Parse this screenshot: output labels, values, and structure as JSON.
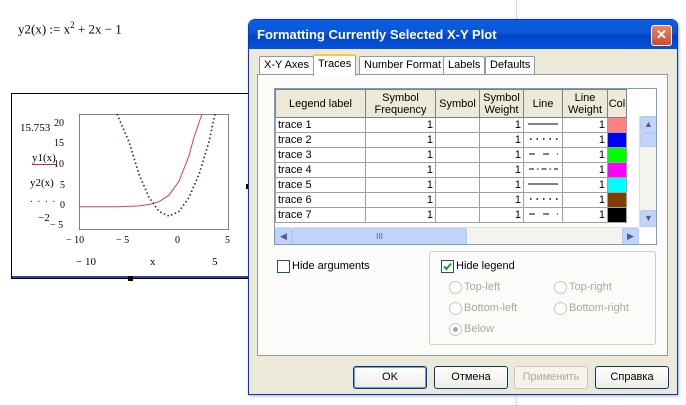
{
  "worksheet": {
    "equation_lhs": "y2(x) := x",
    "equation_exp": "2",
    "equation_rhs": " + 2x − 1",
    "plot": {
      "y_top_label": "15.753",
      "y_bottom_label": "−2",
      "y_trace1": "y1(x)",
      "y_trace2": "y2(x)",
      "x_left_label": "− 10",
      "x_right_label": "5",
      "x_var": "x",
      "y_ticks": [
        "20",
        "15",
        "10",
        "5",
        "0",
        "− 5"
      ],
      "x_ticks": [
        "− 10",
        "− 5",
        "0",
        "5"
      ]
    }
  },
  "chart_data": {
    "type": "line",
    "title": "",
    "xlabel": "x",
    "ylabel": "",
    "xlim": [
      -10,
      5
    ],
    "ylim": [
      -5,
      20
    ],
    "series": [
      {
        "name": "y1(x)",
        "style": "solid",
        "color": "#e04040",
        "x": [
          -10,
          -6,
          -4,
          -3,
          -2,
          -1,
          0,
          1,
          1.5,
          2.3
        ],
        "y": [
          0.0,
          0.02,
          0.2,
          0.5,
          1.1,
          2.5,
          5.5,
          11.0,
          15.0,
          20.0
        ]
      },
      {
        "name": "y2(x)",
        "style": "dotted",
        "color": "#1a1aa0",
        "x": [
          -6.2,
          -5,
          -4,
          -3,
          -2,
          -1,
          0,
          1,
          2,
          3,
          3.6
        ],
        "y": [
          20,
          14,
          7,
          2,
          -1,
          -2,
          -1,
          2,
          7,
          14,
          20
        ]
      }
    ],
    "grid": false,
    "legend": "none"
  },
  "dialog": {
    "title": "Formatting Currently Selected X-Y Plot",
    "tabs": [
      "X-Y Axes",
      "Traces",
      "Number Format",
      "Labels",
      "Defaults"
    ],
    "active_tab": "Traces",
    "columns": [
      "Legend label",
      "Symbol Frequency",
      "Symbol",
      "Symbol Weight",
      "Line",
      "Line Weight",
      "Col"
    ],
    "rows": [
      {
        "label": "trace 1",
        "freq": "1",
        "weight": "1",
        "line": "solid",
        "line_weight": "1",
        "color": "#ff8080"
      },
      {
        "label": "trace 2",
        "freq": "1",
        "weight": "1",
        "line": "dot",
        "line_weight": "1",
        "color": "#0000ff"
      },
      {
        "label": "trace 3",
        "freq": "1",
        "weight": "1",
        "line": "dash",
        "line_weight": "1",
        "color": "#00ff00"
      },
      {
        "label": "trace 4",
        "freq": "1",
        "weight": "1",
        "line": "dashdot",
        "line_weight": "1",
        "color": "#ff00ff"
      },
      {
        "label": "trace 5",
        "freq": "1",
        "weight": "1",
        "line": "solid",
        "line_weight": "1",
        "color": "#00ffff"
      },
      {
        "label": "trace 6",
        "freq": "1",
        "weight": "1",
        "line": "dot",
        "line_weight": "1",
        "color": "#804000"
      },
      {
        "label": "trace 7",
        "freq": "1",
        "weight": "1",
        "line": "dash",
        "line_weight": "1",
        "color": "#000000"
      }
    ],
    "hscroll_grip": "III",
    "hide_arguments": {
      "label": "Hide arguments",
      "checked": false
    },
    "hide_legend": {
      "label": "Hide legend",
      "checked": true
    },
    "legend_positions": [
      "Top-left",
      "Top-right",
      "Bottom-left",
      "Bottom-right",
      "Below"
    ],
    "selected_position": "Below",
    "buttons": {
      "ok": "OK",
      "cancel": "Отмена",
      "apply": "Применить",
      "help": "Справка"
    },
    "close_glyph": "✕"
  }
}
